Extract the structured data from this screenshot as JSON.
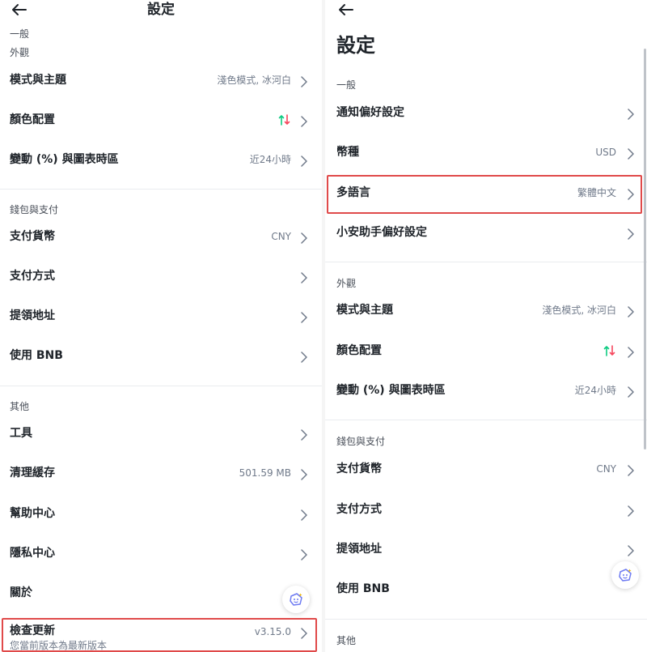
{
  "left": {
    "title": "設定",
    "top_section": "一般",
    "sections": [
      {
        "label": "外觀",
        "rows": [
          {
            "label": "模式與主題",
            "value": "淺色模式, 冰河白"
          },
          {
            "label": "顏色配置",
            "value": ""
          },
          {
            "label": "變動 (%) 與圖表時區",
            "value": "近24小時"
          }
        ]
      },
      {
        "label": "錢包與支付",
        "rows": [
          {
            "label": "支付貨幣",
            "value": "CNY"
          },
          {
            "label": "支付方式",
            "value": ""
          },
          {
            "label": "提領地址",
            "value": ""
          },
          {
            "label": "使用 BNB",
            "value": ""
          }
        ]
      },
      {
        "label": "其他",
        "rows": [
          {
            "label": "工具",
            "value": ""
          },
          {
            "label": "清理緩存",
            "value": "501.59 MB"
          },
          {
            "label": "幫助中心",
            "value": ""
          },
          {
            "label": "隱私中心",
            "value": ""
          },
          {
            "label": "關於",
            "value": ""
          }
        ]
      }
    ],
    "update": {
      "label": "檢查更新",
      "sub": "您當前版本為最新版本",
      "value": "v3.15.0"
    }
  },
  "right": {
    "title": "設定",
    "sections": [
      {
        "label": "一般",
        "rows": [
          {
            "label": "通知偏好設定",
            "value": ""
          },
          {
            "label": "幣種",
            "value": "USD"
          },
          {
            "label": "多語言",
            "value": "繁體中文"
          },
          {
            "label": "小安助手偏好設定",
            "value": ""
          }
        ]
      },
      {
        "label": "外觀",
        "rows": [
          {
            "label": "模式與主題",
            "value": "淺色模式, 冰河白"
          },
          {
            "label": "顏色配置",
            "value": ""
          },
          {
            "label": "變動 (%) 與圖表時區",
            "value": "近24小時"
          }
        ]
      },
      {
        "label": "錢包與支付",
        "rows": [
          {
            "label": "支付貨幣",
            "value": "CNY"
          },
          {
            "label": "支付方式",
            "value": ""
          },
          {
            "label": "提領地址",
            "value": ""
          },
          {
            "label": "使用 BNB",
            "value": ""
          }
        ]
      },
      {
        "label": "其他",
        "rows": []
      }
    ]
  },
  "colors": {
    "up": "#0ecb81",
    "down": "#f6465d",
    "highlight": "#e04a4a",
    "divider": "#eaecef",
    "secondary_text": "#707a8a"
  },
  "icons": {
    "back": "arrow-left-icon",
    "chevron": "chevron-right-icon",
    "color_config": "up-down-arrows-icon",
    "assistant": "assistant-bot-icon"
  }
}
